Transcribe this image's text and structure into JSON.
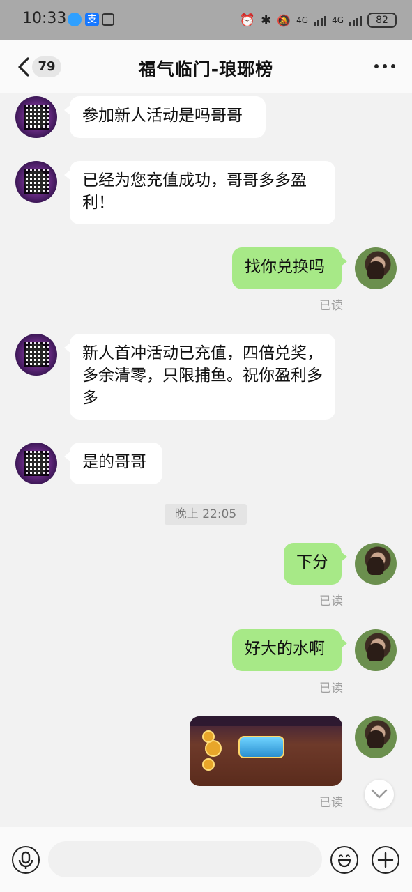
{
  "status_bar": {
    "time": "10:33",
    "network_1": "4G",
    "network_2": "4G",
    "battery": "82"
  },
  "header": {
    "unread_count": "79",
    "title": "福气临门-琅琊榜"
  },
  "messages": [
    {
      "side": "left",
      "text": "参加新人活动是吗哥哥"
    },
    {
      "side": "left",
      "text": "已经为您充值成功，哥哥多多盈利！"
    },
    {
      "side": "right",
      "text": "找你兑换吗",
      "status": "已读"
    },
    {
      "side": "left",
      "text": "新人首冲活动已充值，四倍兑奖，多余清零，只限捕鱼。祝你盈利多多"
    },
    {
      "side": "left",
      "text": "是的哥哥"
    },
    {
      "side": "right",
      "text": "下分",
      "status": "已读"
    },
    {
      "side": "right",
      "text": "好大的水啊",
      "status": "已读"
    },
    {
      "side": "right",
      "type": "image",
      "status": "已读"
    }
  ],
  "time_divider": "晚上 22:05",
  "input": {
    "placeholder": ""
  },
  "colors": {
    "sent_bubble": "#a7e987",
    "received_bubble": "#ffffff",
    "status_bar": "#a9a9a9"
  }
}
